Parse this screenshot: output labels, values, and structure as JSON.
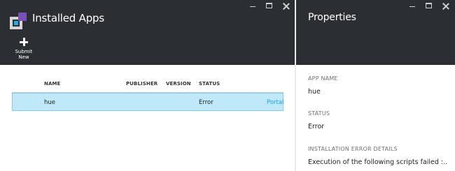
{
  "installed_apps": {
    "title": "Installed Apps",
    "command": {
      "label": "Submit\nNew"
    },
    "columns": [
      "NAME",
      "PUBLISHER",
      "VERSION",
      "STATUS"
    ],
    "rows": [
      {
        "name": "hue",
        "publisher": "",
        "version": "",
        "status": "Error",
        "link": "Portal"
      }
    ]
  },
  "properties": {
    "title": "Properties",
    "fields": [
      {
        "label": "APP NAME",
        "value": "hue"
      },
      {
        "label": "STATUS",
        "value": "Error"
      },
      {
        "label": "INSTALLATION ERROR DETAILS",
        "value": "Execution of the following scripts failed :..."
      }
    ]
  },
  "colors": {
    "topbar": "#2b2f33",
    "selected_row": "#bfe9f8",
    "link": "#1ba1e2",
    "logo_purple": "#7a4fb6",
    "logo_blue": "#27a9e1"
  },
  "icons": [
    "app-logo-icon",
    "plus-icon",
    "minimize-icon",
    "maximize-icon",
    "close-icon"
  ]
}
